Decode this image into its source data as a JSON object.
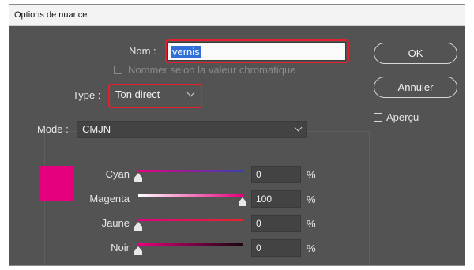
{
  "window": {
    "title": "Options de nuance"
  },
  "nom": {
    "label": "Nom :",
    "value": "vernis"
  },
  "name_by_value": {
    "label": "Nommer selon la valeur chromatique",
    "checked": false,
    "enabled": false
  },
  "type": {
    "label": "Type :",
    "value": "Ton direct"
  },
  "mode": {
    "label": "Mode :",
    "value": "CMJN"
  },
  "buttons": {
    "ok": "OK",
    "cancel": "Annuler"
  },
  "apercu": {
    "label": "Aperçu",
    "checked": false
  },
  "swatch_color": "#e5007e",
  "highlight_color": "#e0202d",
  "sliders": [
    {
      "label": "Cyan",
      "value": "0",
      "unit": "%",
      "fraction": 0
    },
    {
      "label": "Magenta",
      "value": "100",
      "unit": "%",
      "fraction": 1
    },
    {
      "label": "Jaune",
      "value": "0",
      "unit": "%",
      "fraction": 0
    },
    {
      "label": "Noir",
      "value": "0",
      "unit": "%",
      "fraction": 0
    }
  ]
}
